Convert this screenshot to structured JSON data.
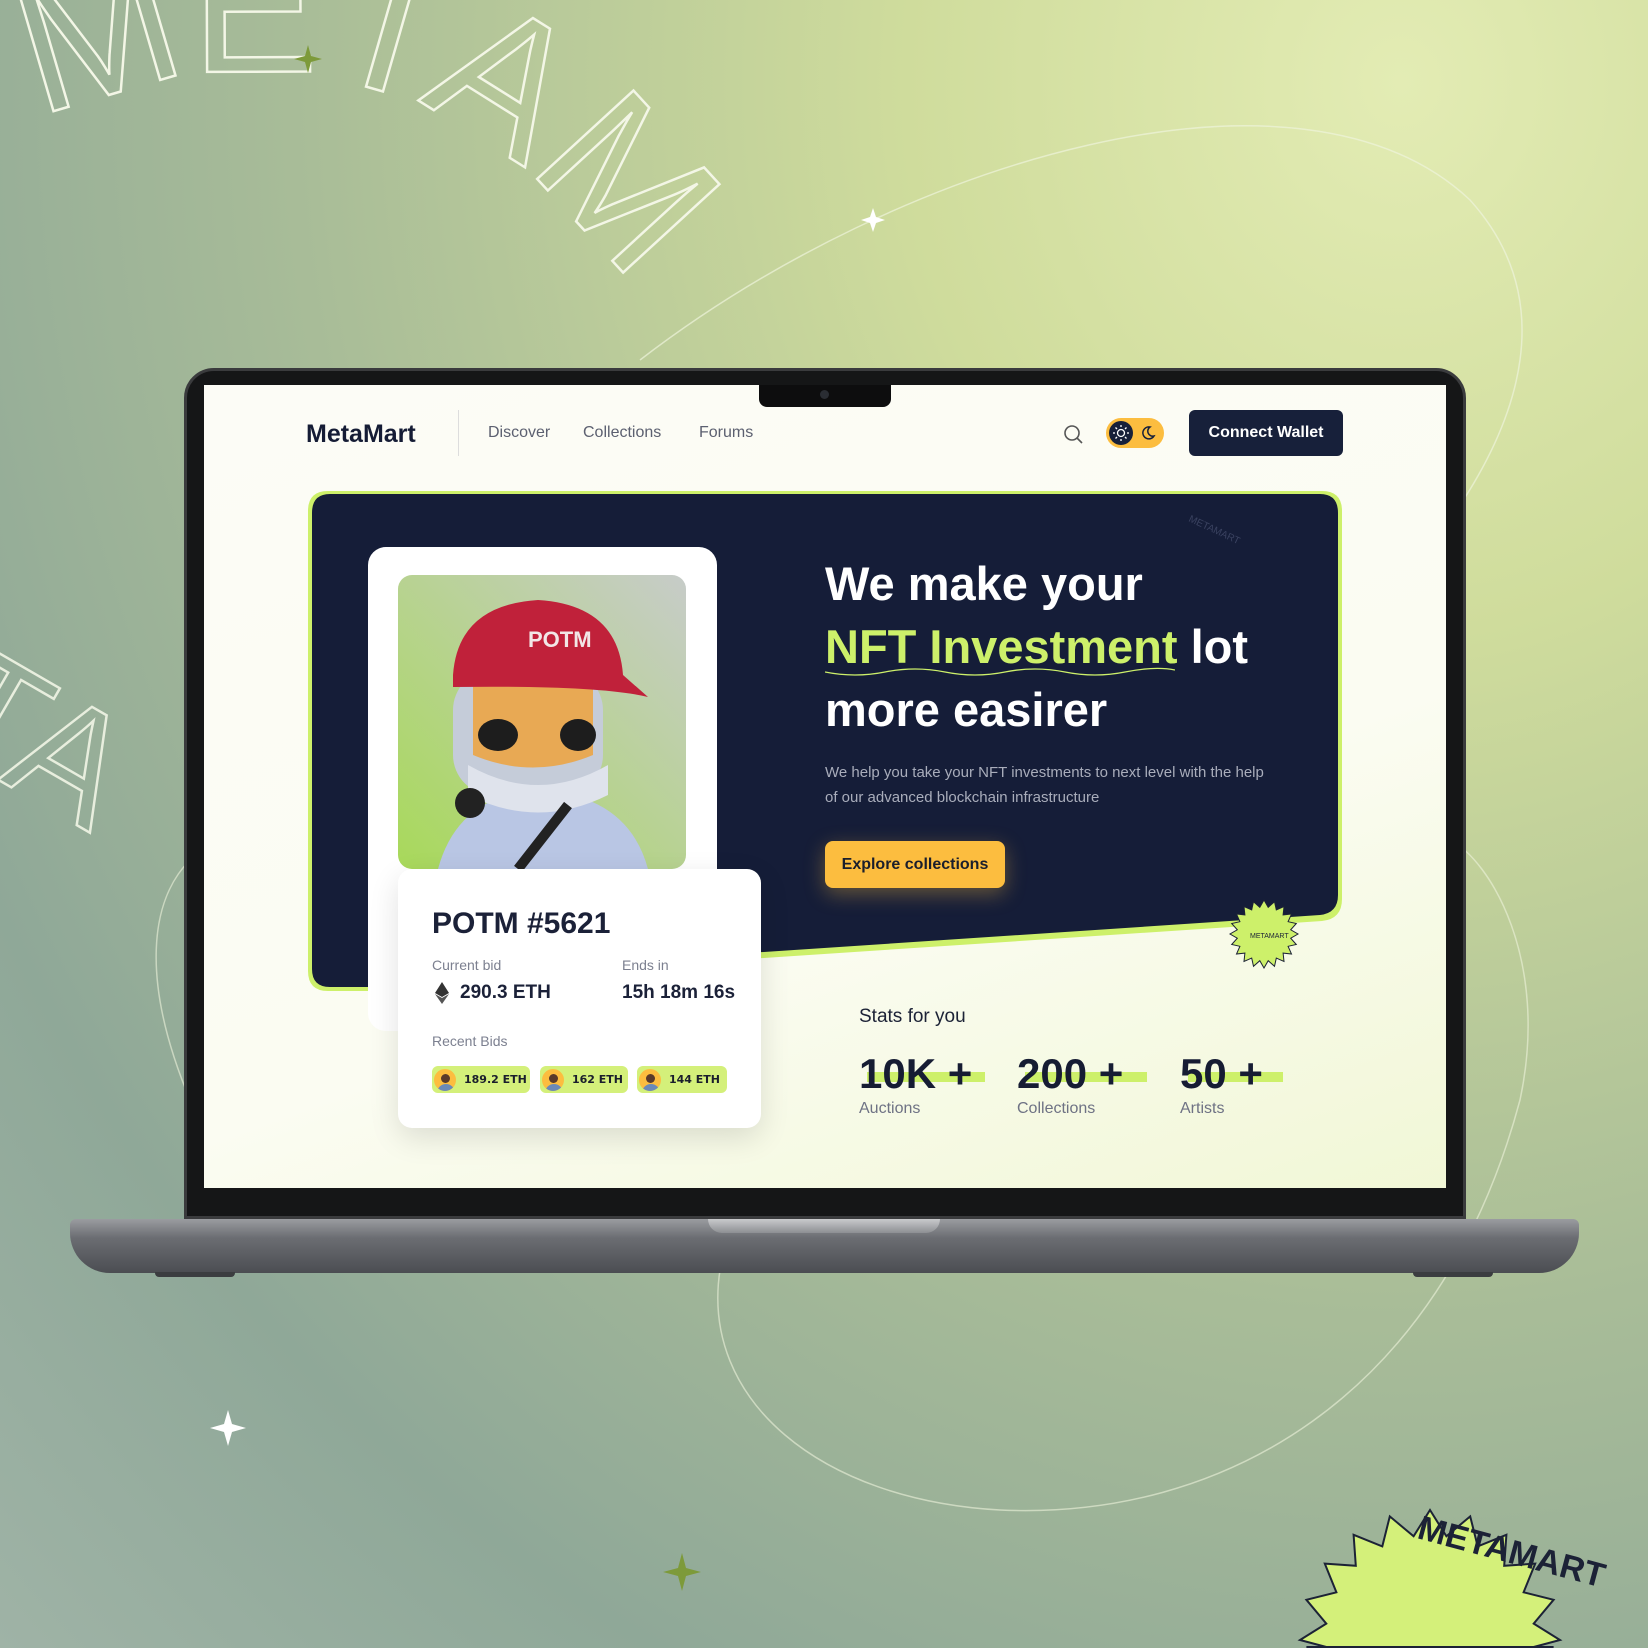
{
  "brand": {
    "name": "MetaMart",
    "watermark": "METAMART",
    "badge_text": "METAMART"
  },
  "nav": {
    "items": [
      {
        "label": "Discover"
      },
      {
        "label": "Collections"
      },
      {
        "label": "Forums"
      }
    ],
    "search_icon": "search-icon",
    "theme_toggle": {
      "icons": [
        "sun-icon",
        "moon-icon"
      ],
      "active": "light"
    },
    "connect_label": "Connect Wallet"
  },
  "hero": {
    "line1": "We make your",
    "highlight": "NFT Investment",
    "line2_rest": " lot",
    "line3": "more easirer",
    "description": "We help you take your NFT investments to next level with the help of our advanced blockchain infrastructure",
    "cta": "Explore collections"
  },
  "nft": {
    "cap_text": "POTM",
    "title": "POTM #5621",
    "current_bid_label": "Current bid",
    "current_bid": "290.3 ETH",
    "ends_label": "Ends in",
    "ends_in": "15h 18m 16s",
    "recent_bids_label": "Recent Bids",
    "recent_bids": [
      {
        "amount": "189.2 ETH"
      },
      {
        "amount": "162 ETH"
      },
      {
        "amount": "144 ETH"
      }
    ]
  },
  "stats": {
    "title": "Stats for you",
    "items": [
      {
        "value": "10K +",
        "label": "Auctions"
      },
      {
        "value": "200 +",
        "label": "Collections"
      },
      {
        "value": "50 +",
        "label": "Artists"
      }
    ]
  },
  "colors": {
    "navy": "#151d38",
    "accent_green": "#cdf06a",
    "accent_yellow": "#fcbd3f"
  }
}
